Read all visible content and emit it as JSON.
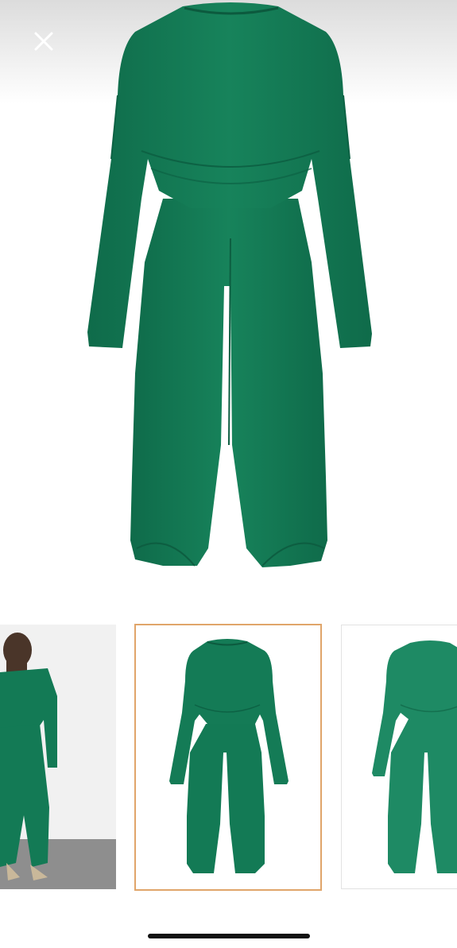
{
  "viewer": {
    "close_icon": "close-icon",
    "selected_thumbnail_index": 1,
    "colors": {
      "garment": "#137a55",
      "garment_dark": "#0e6446",
      "selected_border": "#e0a56a"
    },
    "thumbnails": [
      {
        "name": "model-back-view",
        "selected": false
      },
      {
        "name": "flat-lay-front",
        "selected": true
      },
      {
        "name": "flat-lay-back",
        "selected": false
      }
    ]
  }
}
